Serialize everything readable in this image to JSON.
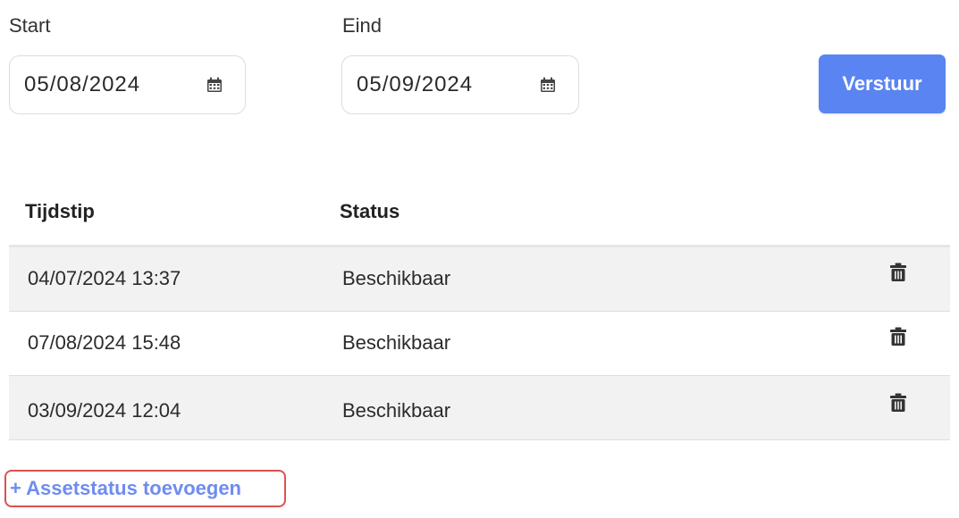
{
  "filters": {
    "start_label": "Start",
    "start_value": "05/08/2024",
    "end_label": "Eind",
    "end_value": "05/09/2024",
    "submit_label": "Verstuur",
    "submit_color": "#5a84f2"
  },
  "table": {
    "headers": [
      "Tijdstip",
      "Status"
    ],
    "rows": [
      {
        "time": "04/07/2024 13:37",
        "status": "Beschikbaar"
      },
      {
        "time": "07/08/2024 15:48",
        "status": "Beschikbaar"
      },
      {
        "time": "03/09/2024 12:04",
        "status": "Beschikbaar"
      }
    ],
    "row_action_icon": "trash-icon"
  },
  "add_link": {
    "label": "+ Assetstatus toevoegen",
    "color": "#6e8cf0",
    "highlight_color": "#d9534f"
  }
}
